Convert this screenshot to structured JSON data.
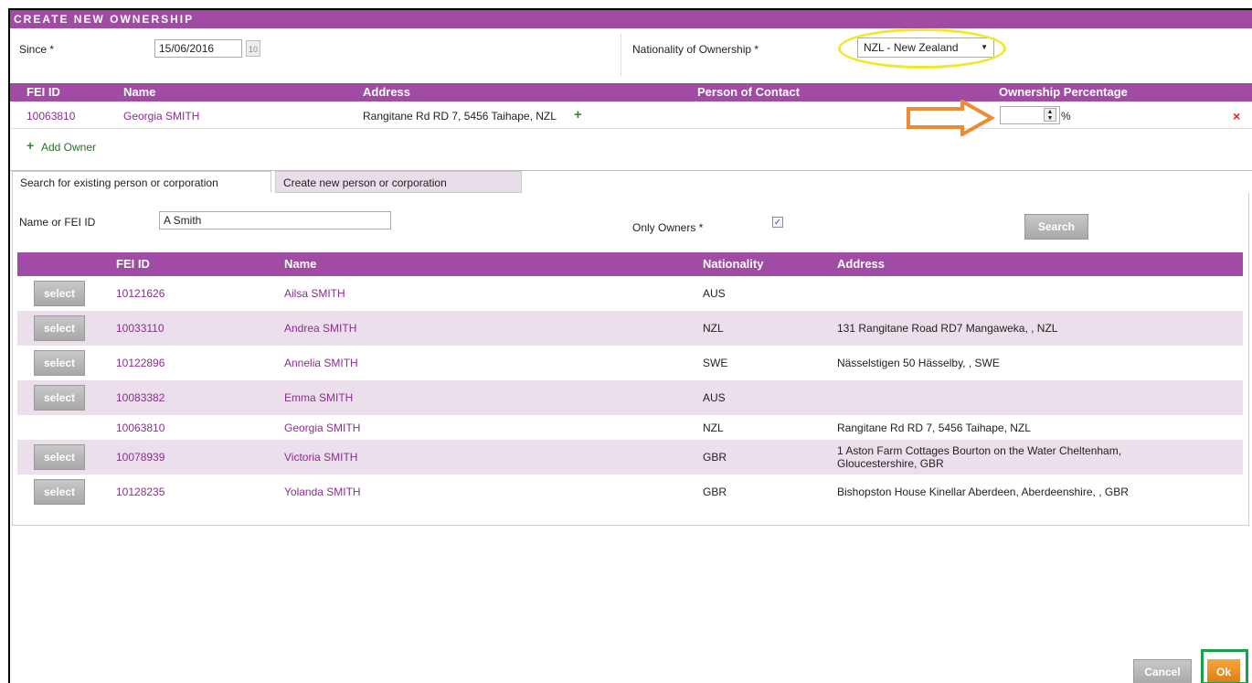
{
  "dialog": {
    "title": "CREATE NEW OWNERSHIP"
  },
  "form": {
    "since_label": "Since *",
    "since_value": "15/06/2016",
    "calendar_icon_text": "10",
    "nationality_label": "Nationality of Ownership *",
    "nationality_value": "NZL - New Zealand"
  },
  "ownership_table": {
    "headers": [
      "FEI ID",
      "Name",
      "Address",
      "Person of Contact",
      "Ownership Percentage"
    ],
    "rows": [
      {
        "fei_id": "10063810",
        "name": "Georgia SMITH",
        "address": "Rangitane Rd RD 7, 5456 Taihape, NZL",
        "percent_symbol": "%"
      }
    ],
    "add_owner_label": "Add Owner"
  },
  "tabs": [
    "Search for existing person or corporation",
    "Create new person or corporation"
  ],
  "search": {
    "name_label": "Name or FEI ID",
    "name_value": "A Smith",
    "only_owners_label": "Only Owners *",
    "only_owners_checked": true,
    "search_button": "Search"
  },
  "results": {
    "headers": [
      "FEI ID",
      "Name",
      "Nationality",
      "Address"
    ],
    "select_label": "select",
    "rows": [
      {
        "fei_id": "10121626",
        "name": "Ailsa SMITH",
        "nationality": "AUS",
        "address": "",
        "has_select": true
      },
      {
        "fei_id": "10033110",
        "name": "Andrea SMITH",
        "nationality": "NZL",
        "address": "131 Rangitane Road RD7 Mangaweka, , NZL",
        "has_select": true
      },
      {
        "fei_id": "10122896",
        "name": "Annelia SMITH",
        "nationality": "SWE",
        "address": "Nässelstigen 50 Hässelby, , SWE",
        "has_select": true
      },
      {
        "fei_id": "10083382",
        "name": "Emma SMITH",
        "nationality": "AUS",
        "address": "",
        "has_select": true
      },
      {
        "fei_id": "10063810",
        "name": "Georgia SMITH",
        "nationality": "NZL",
        "address": "Rangitane Rd RD 7, 5456 Taihape, NZL",
        "has_select": false
      },
      {
        "fei_id": "10078939",
        "name": "Victoria SMITH",
        "nationality": "GBR",
        "address": "1 Aston Farm Cottages Bourton on the Water Cheltenham, Gloucestershire, GBR",
        "has_select": true
      },
      {
        "fei_id": "10128235",
        "name": "Yolanda SMITH",
        "nationality": "GBR",
        "address": "Bishopston House Kinellar Aberdeen, Aberdeenshire, , GBR",
        "has_select": true
      }
    ]
  },
  "footer": {
    "cancel_label": "Cancel",
    "ok_label": "Ok"
  },
  "colors": {
    "header_purple": "#a04ba4",
    "link_purple": "#8b2f8f",
    "highlight_yellow": "#f0e92a",
    "arrow_orange": "#f08a30",
    "ok_orange": "#e88a20",
    "box_green": "#1aa24a"
  }
}
